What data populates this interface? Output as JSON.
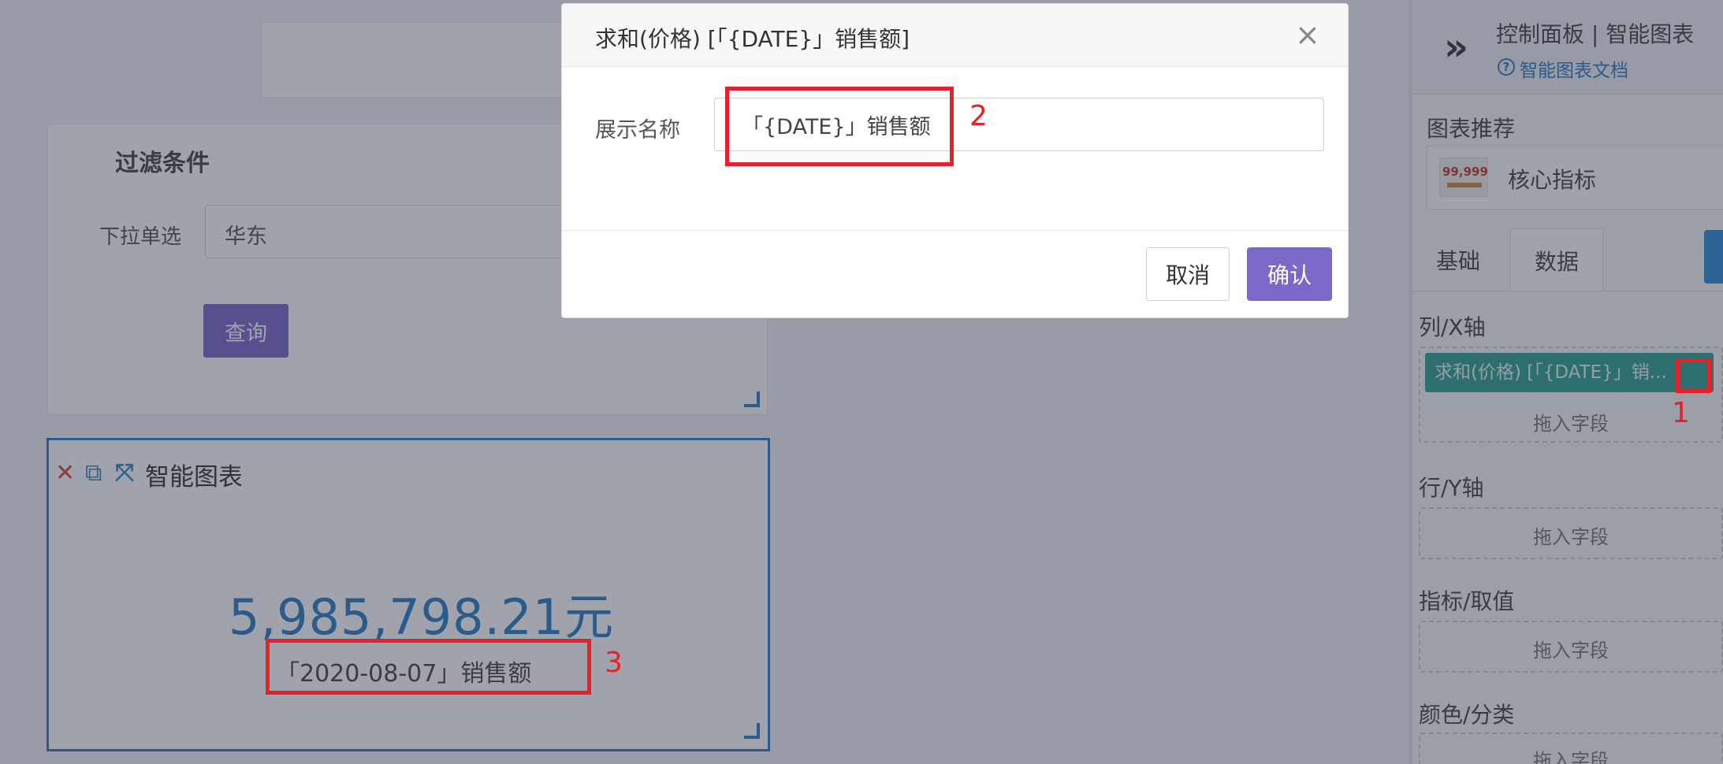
{
  "canvas": {
    "filter": {
      "title": "过滤条件",
      "select_label": "下拉单选",
      "select_value": "华东",
      "query_button": "查询"
    },
    "chart": {
      "title": "智能图表",
      "kpi_value": "5,985,798.21元",
      "kpi_label": "「2020-08-07」销售额",
      "toolbar": {
        "delete_icon": "close-icon",
        "copy_icon": "copy-icon",
        "fullscreen_icon": "expand-icon"
      }
    }
  },
  "panel": {
    "title": "控制面板 | 智能图表",
    "doc_link": "智能图表文档",
    "recommend_label": "图表推荐",
    "recommend_item": "核心指标",
    "recommend_thumb_text": "99,999",
    "tabs": [
      "基础",
      "数据"
    ],
    "active_tab": "数据",
    "sections": {
      "x_axis": "列/X轴",
      "y_axis": "行/Y轴",
      "metric": "指标/取值",
      "color": "颜色/分类"
    },
    "x_field": "求和(价格) [「{DATE}」销...",
    "drop_placeholder": "拖入字段"
  },
  "modal": {
    "title": "求和(价格) [「{DATE}」销售额]",
    "field_label": "展示名称",
    "field_value": "「{DATE}」销售额",
    "cancel": "取消",
    "confirm": "确认"
  },
  "annotations": {
    "one": "1",
    "two": "2",
    "three": "3"
  },
  "colors": {
    "primary": "#7b68c8",
    "accent_blue": "#2a7fc4",
    "field_teal": "#2fa190",
    "annotation_red": "#e8202a"
  }
}
